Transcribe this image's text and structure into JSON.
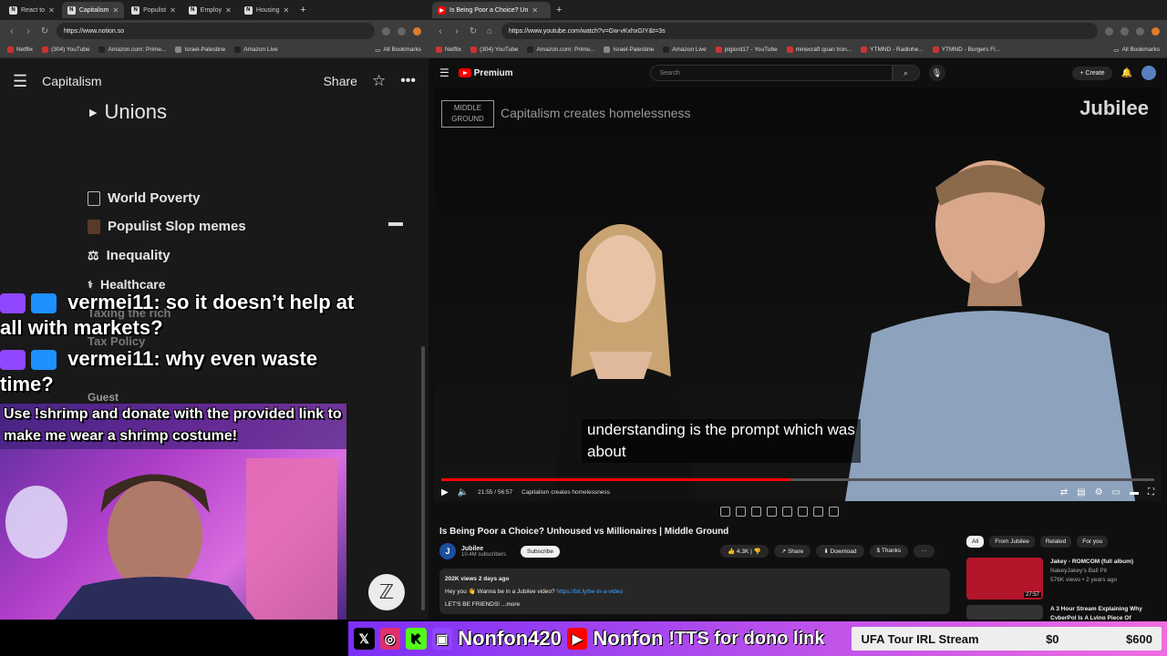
{
  "left_browser": {
    "tabs": [
      {
        "label": "React to"
      },
      {
        "label": "Capitalism",
        "active": true
      },
      {
        "label": "Populist"
      },
      {
        "label": "Employ"
      },
      {
        "label": "Housing"
      }
    ],
    "url": "https://www.notion.so",
    "bookmarks": [
      "Netflix",
      "(304) YouTube",
      "Amazon.com: Prime...",
      "Israel-Palestine",
      "Amazon Live",
      "All Bookmarks"
    ]
  },
  "notion": {
    "page_title": "Capitalism",
    "share_label": "Share",
    "toggle_item": "Unions",
    "items": [
      {
        "label": "World Poverty"
      },
      {
        "label": "Populist Slop memes"
      },
      {
        "label": "Inequality"
      },
      {
        "label": "Healthcare"
      },
      {
        "label": "Taxing the rich"
      },
      {
        "label": "Tax Policy"
      },
      {
        "label": "Guest"
      }
    ]
  },
  "right_browser": {
    "tab": "Is Being Poor a Choice? Un",
    "url": "https://www.youtube.com/watch?v=Gw-vKxhxGIY&t=3s",
    "bookmarks": [
      "Netflix",
      "(304) YouTube",
      "Amazon.com: Prime...",
      "Israel-Palestine",
      "Amazon Live",
      "pigiord17 - YouTube",
      "minecraft quan tron...",
      "YTMND - Radiohe...",
      "YTMND - Burgers Fl...",
      "All Bookmarks"
    ]
  },
  "youtube": {
    "logo": "Premium",
    "search_placeholder": "Search",
    "create_label": "Create",
    "video": {
      "brand": "MIDDLE GROUND",
      "topic": "Capitalism creates homelessness",
      "watermark": "Jubilee",
      "caption_line1": "understanding is the prompt which was",
      "caption_line2": "about",
      "time": "21:55 / 56:57",
      "chapter": "Capitalism creates homelessness",
      "progress": 0.49
    },
    "title": "Is Being Poor a Choice? Unhoused vs Millionaires | Middle Ground",
    "channel": "Jubilee",
    "subscribers": "10.4M subscribers",
    "subscribe_label": "Subscribe",
    "likes": "4.3K",
    "share_label": "Share",
    "download_label": "Download",
    "thanks_label": "Thanks",
    "views_line": "202K views  2 days ago",
    "desc_line": "Hey you 👋 Wanna be in a Jubilee video?",
    "desc_link": "https://bit.ly/be-in-a-video",
    "desc_more": "LET'S BE FRIENDS! ...more",
    "chips": [
      "All",
      "From Jubilee",
      "Related",
      "For you"
    ],
    "recs": [
      {
        "title": "Jakey - ROMCOM (full album)",
        "channel": "NakeyJakey's Ball Pit",
        "meta": "576K views • 2 years ago",
        "duration": "27:57"
      },
      {
        "title": "A 3 Hour Stream Explaining Why CyberPol Is A Lying Piece Of",
        "channel": "",
        "meta": "",
        "duration": ""
      }
    ]
  },
  "stream": {
    "chat": [
      {
        "user": "vermei11:",
        "message": "so it doesn’t help at all with markets?"
      },
      {
        "user": "vermei11:",
        "message": "why even waste time?"
      }
    ],
    "shrimp_banner": "Use !shrimp and donate with the provided link to make me wear a shrimp costume!",
    "socials": [
      "Nonfon420",
      "Nonfon"
    ],
    "tts": "!TTS for dono link",
    "goal_label": "UFA Tour IRL Stream",
    "goal_current": "$0",
    "goal_target": "$600"
  }
}
